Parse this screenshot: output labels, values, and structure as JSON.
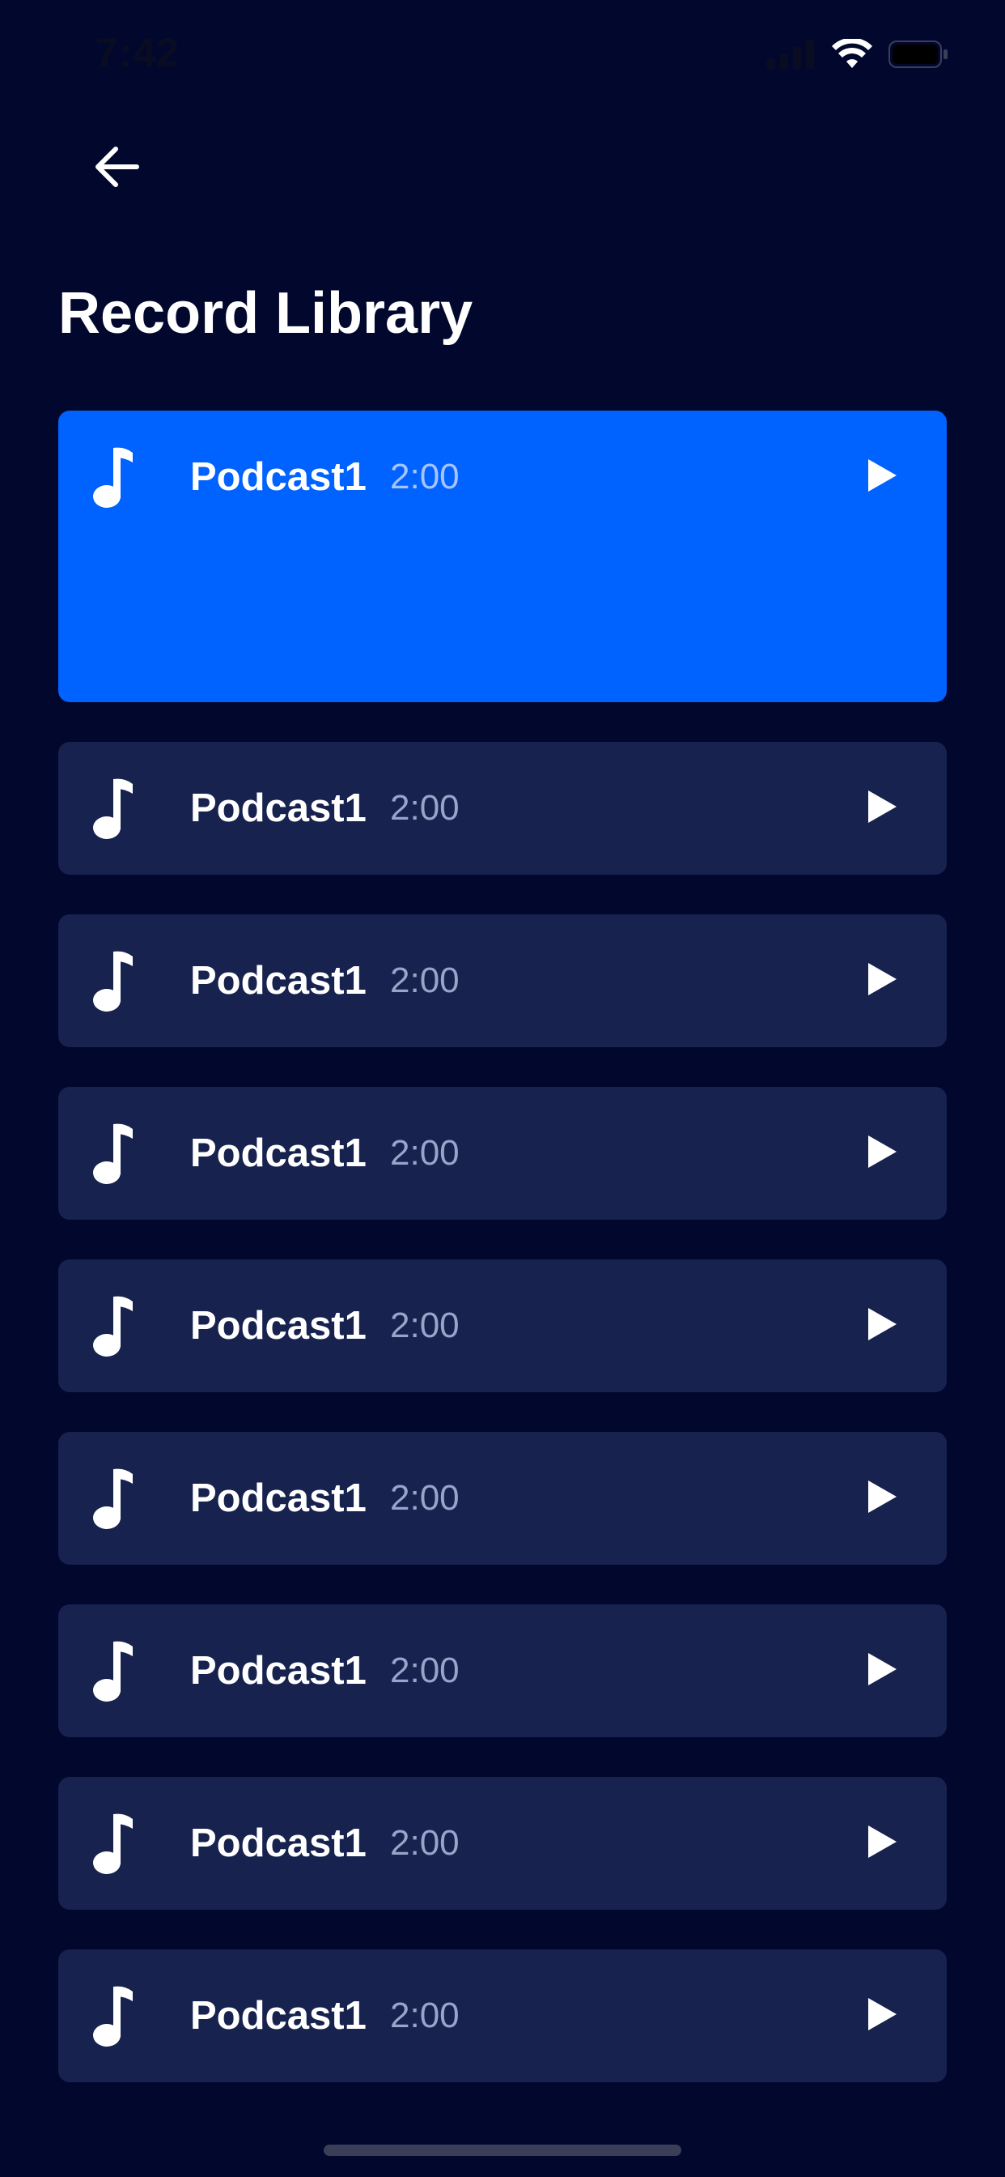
{
  "status_bar": {
    "time": "7:42"
  },
  "header": {
    "back_icon": "arrow-left-icon",
    "title": "Record Library"
  },
  "records": [
    {
      "title": "Podcast1",
      "duration": "2:00",
      "active": true
    },
    {
      "title": "Podcast1",
      "duration": "2:00",
      "active": false
    },
    {
      "title": "Podcast1",
      "duration": "2:00",
      "active": false
    },
    {
      "title": "Podcast1",
      "duration": "2:00",
      "active": false
    },
    {
      "title": "Podcast1",
      "duration": "2:00",
      "active": false
    },
    {
      "title": "Podcast1",
      "duration": "2:00",
      "active": false
    },
    {
      "title": "Podcast1",
      "duration": "2:00",
      "active": false
    },
    {
      "title": "Podcast1",
      "duration": "2:00",
      "active": false
    },
    {
      "title": "Podcast1",
      "duration": "2:00",
      "active": false
    }
  ],
  "colors": {
    "background": "#02072d",
    "card": "#17224f",
    "active_card": "#0062ff",
    "text": "#ffffff",
    "muted_text": "#9aa4c8"
  },
  "icons": {
    "track": "music-note-icon",
    "play": "play-icon"
  }
}
